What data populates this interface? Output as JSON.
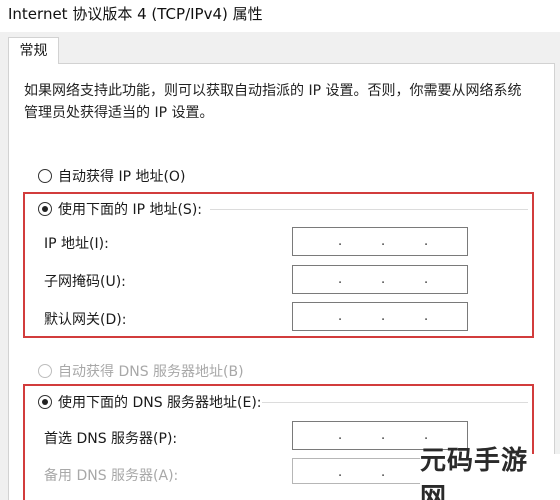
{
  "window": {
    "title": "Internet 协议版本 4 (TCP/IPv4) 属性"
  },
  "tabs": [
    {
      "label": "常规",
      "selected": true
    }
  ],
  "general": {
    "description": "如果网络支持此功能，则可以获取自动指派的 IP 设置。否则，你需要从网络系统管理员处获得适当的 IP 设置。",
    "auto_ip_label": "自动获得 IP 地址(O)",
    "manual_ip_label": "使用下面的 IP 地址(S):",
    "ip_selection": "manual",
    "fields": {
      "ip_address": {
        "label": "IP 地址(I):",
        "value": ""
      },
      "subnet_mask": {
        "label": "子网掩码(U):",
        "value": ""
      },
      "default_gateway": {
        "label": "默认网关(D):",
        "value": ""
      }
    },
    "auto_dns_label": "自动获得 DNS 服务器地址(B)",
    "manual_dns_label": "使用下面的 DNS 服务器地址(E):",
    "dns_selection": "manual",
    "dns_fields": {
      "preferred": {
        "label": "首选 DNS 服务器(P):",
        "value": ""
      },
      "alternate": {
        "label": "备用 DNS 服务器(A):",
        "value": ""
      }
    }
  },
  "ip_separator": ".",
  "highlight_color": "#d23c3c",
  "watermark": {
    "text": "元码手游网"
  }
}
